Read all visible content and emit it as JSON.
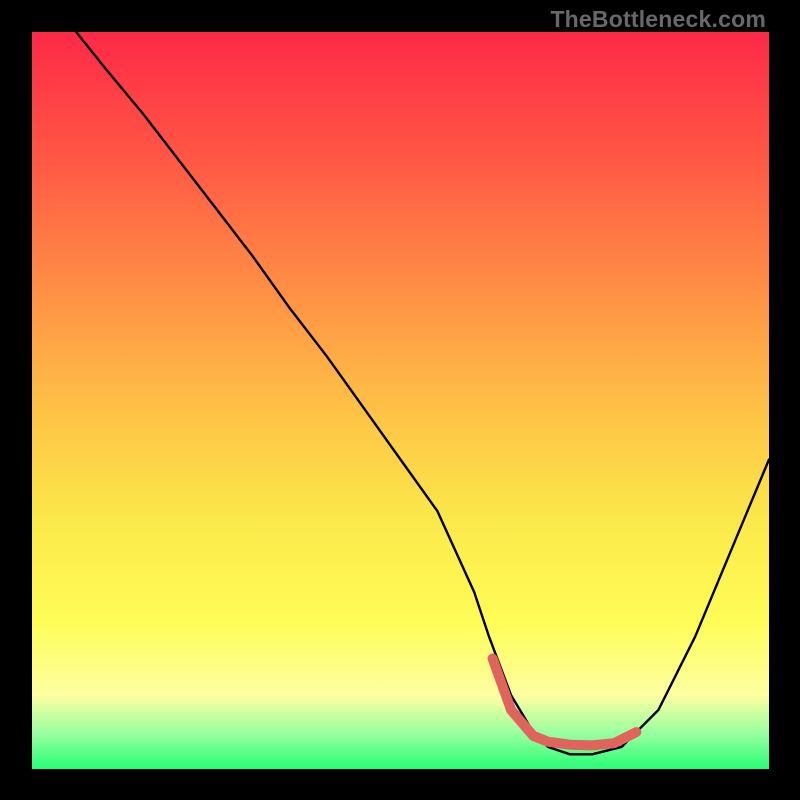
{
  "watermark": "TheBottleneck.com",
  "chart_data": {
    "type": "line",
    "title": "",
    "xlabel": "",
    "ylabel": "",
    "xlim": [
      0,
      100
    ],
    "ylim": [
      0,
      100
    ],
    "grid": false,
    "x": [
      6,
      10,
      15,
      20,
      25,
      30,
      35,
      40,
      45,
      50,
      55,
      60,
      62,
      65,
      68,
      70,
      73,
      76,
      80,
      85,
      90,
      95,
      100
    ],
    "y": [
      100,
      95,
      89,
      82.5,
      76,
      69.5,
      62.5,
      56,
      49,
      42,
      35,
      24,
      18,
      10,
      5,
      3,
      2,
      2,
      3,
      8,
      18,
      30,
      42
    ],
    "highlight": {
      "x": [
        62.5,
        65,
        68,
        70,
        73,
        76,
        79,
        82
      ],
      "y": [
        15,
        8,
        4.5,
        3.7,
        3.3,
        3.2,
        3.5,
        5
      ]
    },
    "colors": {
      "curve": "#000000",
      "highlight": "#e0635c",
      "gradient_top": "#fe2946",
      "gradient_bottom": "#28fe75"
    }
  }
}
